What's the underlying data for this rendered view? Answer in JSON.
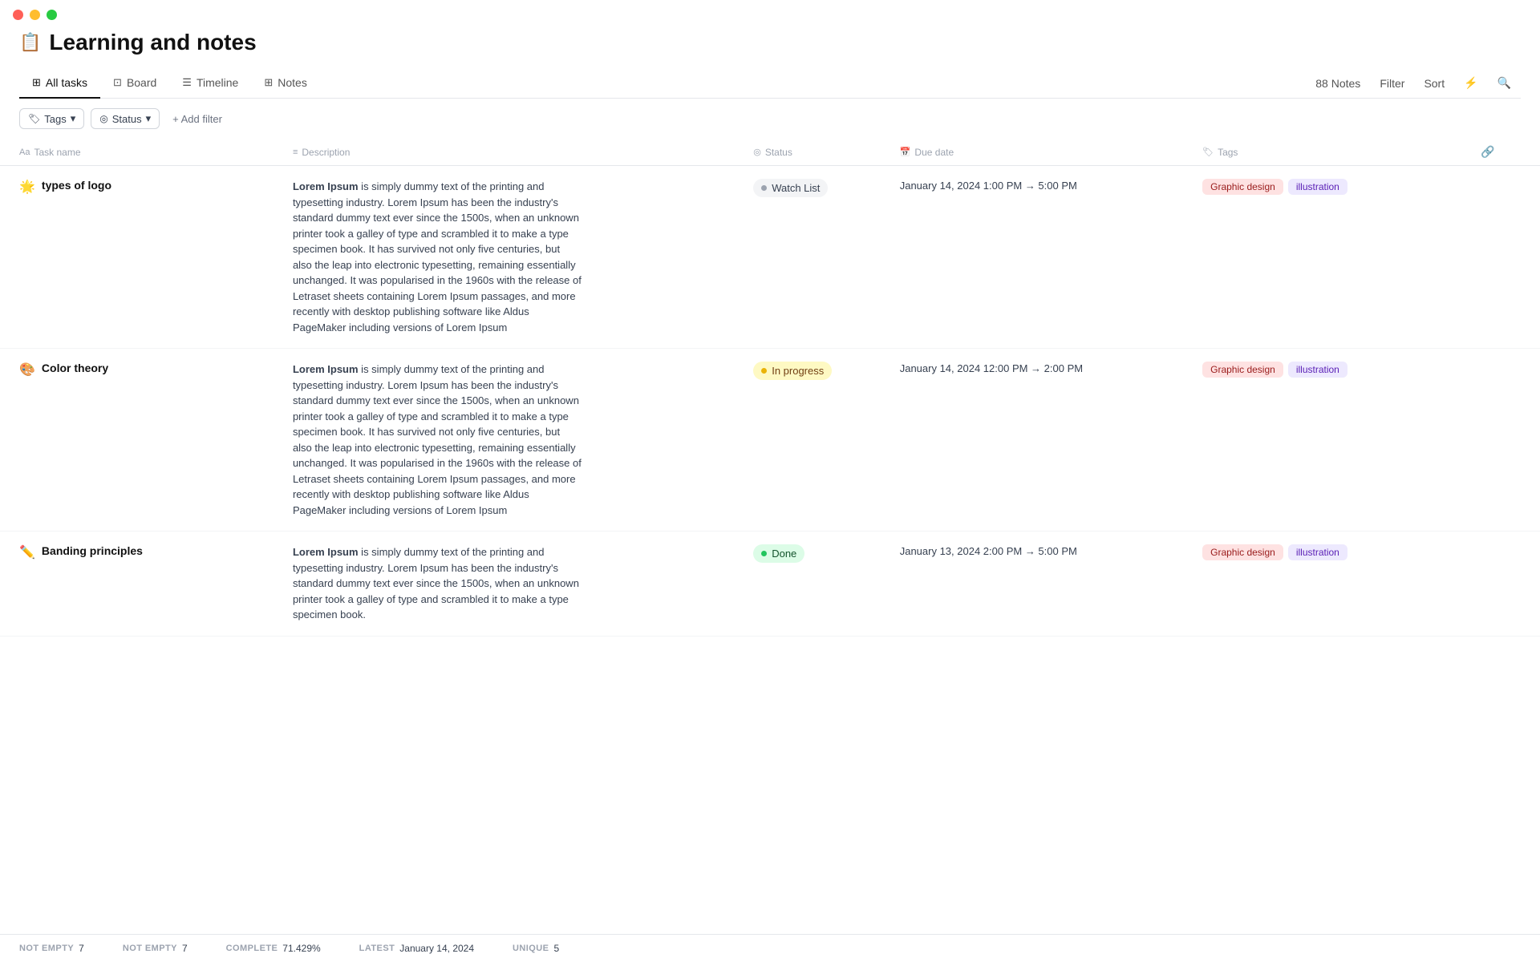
{
  "window": {
    "title": "Learning and notes"
  },
  "page": {
    "icon": "📋",
    "title": "Learning and notes"
  },
  "tabs": [
    {
      "id": "all-tasks",
      "label": "All tasks",
      "icon": "⊞",
      "active": true
    },
    {
      "id": "board",
      "label": "Board",
      "icon": "⊡",
      "active": false
    },
    {
      "id": "timeline",
      "label": "Timeline",
      "icon": "☰",
      "active": false
    },
    {
      "id": "notes",
      "label": "Notes",
      "icon": "⊞",
      "active": false
    }
  ],
  "toolbar_right": {
    "notes_count": "88 Notes",
    "filter_label": "Filter",
    "sort_label": "Sort"
  },
  "filters": {
    "tags_label": "Tags",
    "status_label": "Status",
    "add_filter_label": "+ Add filter"
  },
  "columns": [
    {
      "id": "task-name",
      "label": "Task name",
      "icon": "Aa"
    },
    {
      "id": "description",
      "label": "Description",
      "icon": "≡"
    },
    {
      "id": "status",
      "label": "Status",
      "icon": "◎"
    },
    {
      "id": "due-date",
      "label": "Due date",
      "icon": "📅"
    },
    {
      "id": "tags",
      "label": "Tags",
      "icon": "🏷"
    }
  ],
  "tasks": [
    {
      "id": 1,
      "emoji": "🌟",
      "name": "types of logo",
      "description": "Lorem Ipsum is simply dummy text of the printing and typesetting industry. Lorem Ipsum has been the industry's standard dummy text ever since the 1500s, when an unknown printer took a galley of type and scrambled it to make a type specimen book. It has survived not only five centuries, but also the leap into electronic typesetting, remaining essentially unchanged. It was popularised in the 1960s with the release of Letraset sheets containing Lorem Ipsum passages, and more recently with desktop publishing software like Aldus PageMaker including versions of Lorem Ipsum",
      "desc_bold": "Lorem Ipsum",
      "status": "Watch List",
      "status_type": "watchlist",
      "due_date": "January 14, 2024 1:00 PM → 5:00 PM",
      "tags": [
        "Graphic design",
        "illustration"
      ]
    },
    {
      "id": 2,
      "emoji": "🎨",
      "name": "Color theory",
      "description": "Lorem Ipsum is simply dummy text of the printing and typesetting industry. Lorem Ipsum has been the industry's standard dummy text ever since the 1500s, when an unknown printer took a galley of type and scrambled it to make a type specimen book. It has survived not only five centuries, but also the leap into electronic typesetting, remaining essentially unchanged. It was popularised in the 1960s with the release of Letraset sheets containing Lorem Ipsum passages, and more recently with desktop publishing software like Aldus PageMaker including versions of Lorem Ipsum",
      "desc_bold": "Lorem Ipsum",
      "status": "In progress",
      "status_type": "inprogress",
      "due_date": "January 14, 2024 12:00 PM → 2:00 PM",
      "tags": [
        "Graphic design",
        "illustration"
      ]
    },
    {
      "id": 3,
      "emoji": "✏️",
      "name": "Banding principles",
      "description": "Lorem Ipsum is simply dummy text of the printing and typesetting industry. Lorem Ipsum has been the industry's standard dummy text ever since the 1500s, when an unknown printer took a galley of type and scrambled it to make a type specimen book.",
      "desc_bold": "Lorem Ipsum",
      "status": "Done",
      "status_type": "done",
      "due_date": "January 13, 2024 2:00 PM → 5:00 PM",
      "tags": [
        "Graphic design",
        "illustration"
      ]
    }
  ],
  "footer": {
    "stats": [
      {
        "label": "NOT EMPTY",
        "value": "7"
      },
      {
        "label": "NOT EMPTY",
        "value": "7"
      },
      {
        "label": "COMPLETE",
        "value": "71.429%"
      },
      {
        "label": "LATEST",
        "value": "January 14, 2024"
      },
      {
        "label": "UNIQUE",
        "value": "5"
      }
    ]
  }
}
